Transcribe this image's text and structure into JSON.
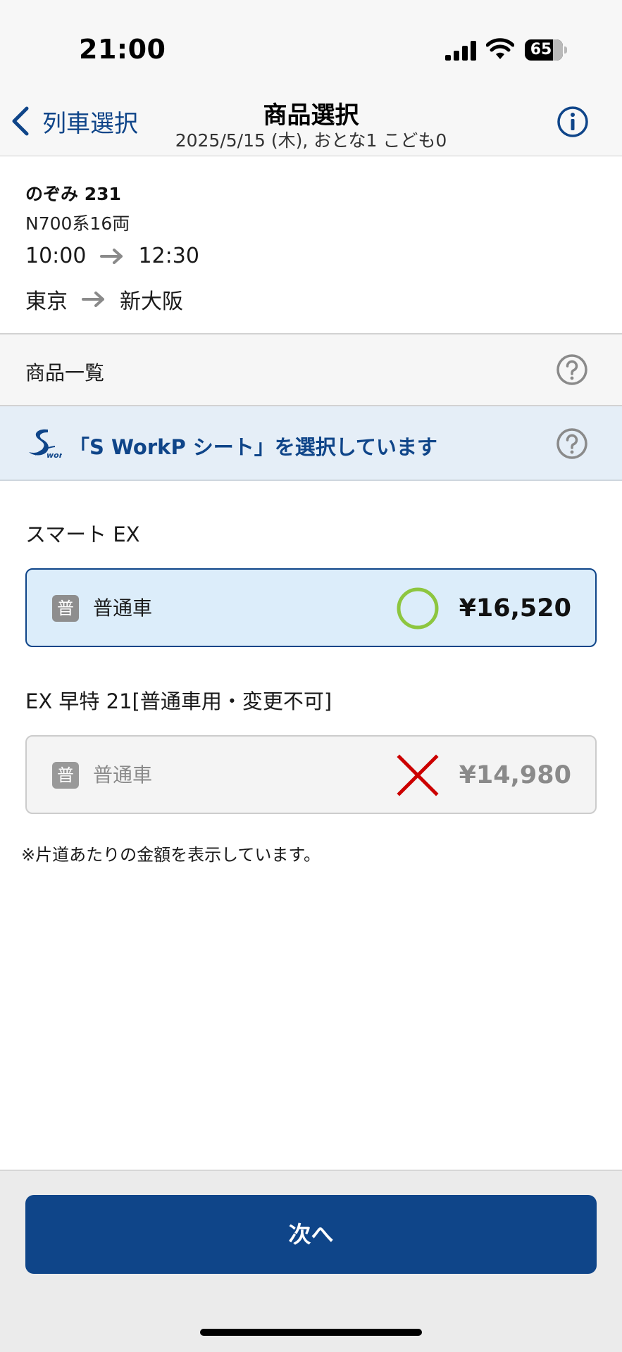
{
  "status_bar": {
    "time": "21:00",
    "battery_level": "65",
    "icons": [
      "signal-icon",
      "wifi-icon",
      "battery-icon"
    ]
  },
  "nav": {
    "back_label": "列車選択",
    "title": "商品選択",
    "subtitle": "2025/5/15 (木), おとな1 こども0",
    "icons": [
      "chevron-left-icon",
      "info-icon"
    ]
  },
  "train": {
    "name": "のぞみ 231",
    "car_type": "N700系16両",
    "depart_time": "10:00",
    "arrive_time": "12:30",
    "from_station": "東京",
    "to_station": "新大阪"
  },
  "product_list": {
    "header": "商品一覧",
    "banner_text": "「S WorkP シート」を選択しています",
    "logo_text": "work"
  },
  "products": [
    {
      "section": "スマート EX",
      "badge": "普",
      "car_class": "普通車",
      "availability": "available",
      "availability_icon": "circle-mark-icon",
      "price": "¥16,520",
      "selected": true
    },
    {
      "section": "EX 早特 21[普通車用・変更不可]",
      "badge": "普",
      "car_class": "普通車",
      "availability": "unavailable",
      "availability_icon": "cross-mark-icon",
      "price": "¥14,980",
      "selected": false
    }
  ],
  "note": "※片道あたりの金額を表示しています。",
  "footer": {
    "next_label": "次へ"
  },
  "colors": {
    "brand_blue": "#0f4589",
    "selected_bg": "#dcedfa",
    "banner_bg": "#e5eef7",
    "available_green": "#8dc63f",
    "unavailable_red": "#cc0000"
  }
}
